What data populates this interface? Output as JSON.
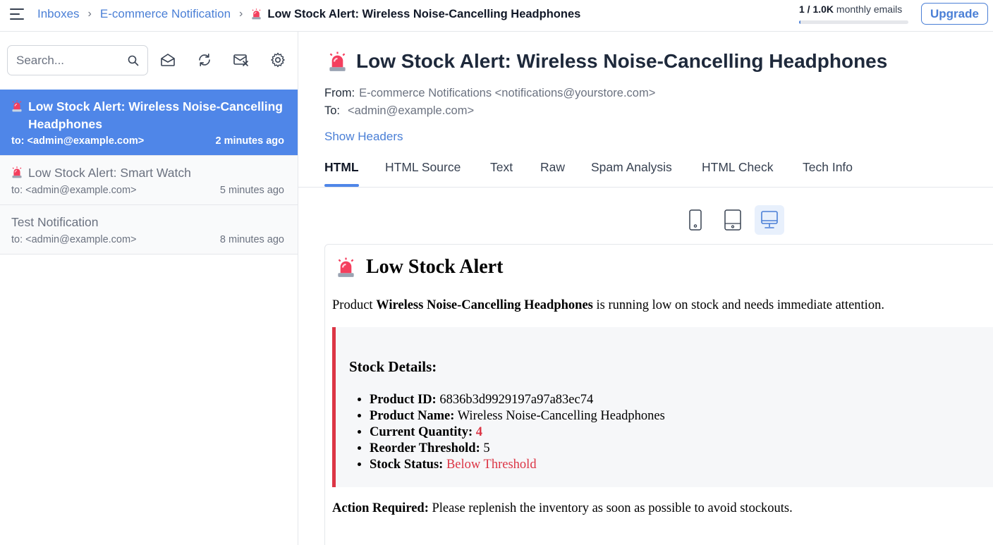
{
  "header": {
    "breadcrumbs": [
      "Inboxes",
      "E-commerce Notification"
    ],
    "current_subject": "Low Stock Alert: Wireless Noise-Cancelling Headphones",
    "usage": {
      "used": "1 / 1.0K",
      "label": "monthly emails",
      "fraction": 0.001
    },
    "upgrade_label": "Upgrade"
  },
  "sidebar": {
    "search_placeholder": "Search...",
    "toolbar_icons": [
      "mail-open-icon",
      "refresh-icon",
      "clear-inbox-icon",
      "gear-icon"
    ],
    "emails": [
      {
        "subject": "Low Stock Alert: Wireless Noise-Cancelling Headphones",
        "to": "to: <admin@example.com>",
        "time": "2 minutes ago",
        "icon": "siren-icon",
        "active": true
      },
      {
        "subject": "Low Stock Alert: Smart Watch",
        "to": "to: <admin@example.com>",
        "time": "5 minutes ago",
        "icon": "siren-icon",
        "active": false
      },
      {
        "subject": "Test Notification",
        "to": "to: <admin@example.com>",
        "time": "8 minutes ago",
        "icon": "",
        "active": false
      }
    ]
  },
  "message": {
    "title": "Low Stock Alert: Wireless Noise-Cancelling Headphones",
    "from_label": "From:",
    "from_value": "E-commerce Notifications <notifications@yourstore.com>",
    "to_label": "To:",
    "to_value": "<admin@example.com>",
    "show_headers": "Show Headers",
    "tabs": [
      "HTML",
      "HTML Source",
      "Text",
      "Raw",
      "Spam Analysis",
      "HTML Check",
      "Tech Info"
    ],
    "active_tab": "HTML",
    "devices": [
      "mobile",
      "tablet",
      "desktop"
    ],
    "active_device": "desktop"
  },
  "preview": {
    "heading": "Low Stock Alert",
    "intro_prefix": "Product ",
    "intro_product": "Wireless Noise-Cancelling Headphones",
    "intro_suffix": " is running low on stock and needs immediate attention.",
    "stock_title": "Stock Details:",
    "details": [
      {
        "label": "Product ID:",
        "value": "6836b3d9929197a97a83ec74"
      },
      {
        "label": "Product Name:",
        "value": "Wireless Noise-Cancelling Headphones"
      },
      {
        "label": "Current Quantity:",
        "value": "4"
      },
      {
        "label": "Reorder Threshold:",
        "value": "5"
      },
      {
        "label": "Stock Status:",
        "value": "Below Threshold"
      }
    ],
    "action_label": "Action Required:",
    "action_text": " Please replenish the inventory as soon as possible to avoid stockouts."
  },
  "colors": {
    "accent": "#4f86e8",
    "link": "#4a7fd6",
    "alert_red": "#dc3545"
  }
}
